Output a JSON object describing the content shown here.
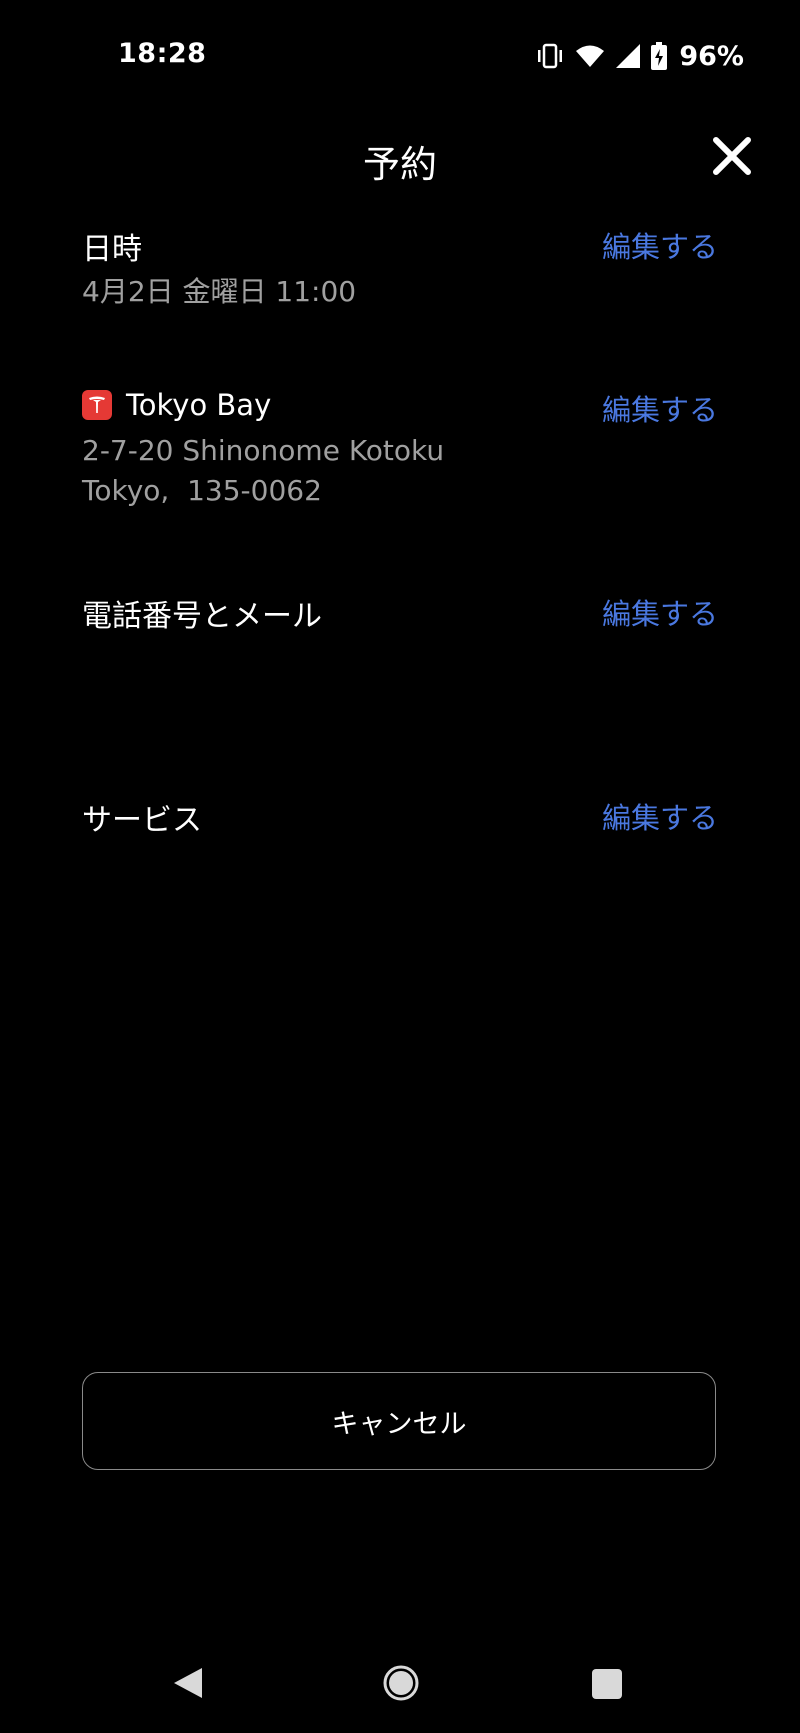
{
  "status_bar": {
    "time": "18:28",
    "battery_percent": "96%",
    "icons": [
      "vibrate-icon",
      "wifi-icon",
      "cell-signal-icon",
      "battery-charging-icon"
    ]
  },
  "header": {
    "title": "予約",
    "close_icon": "close-icon"
  },
  "sections": {
    "datetime": {
      "label": "日時",
      "value": "4月2日 金曜日 11:00",
      "edit": "編集する"
    },
    "location": {
      "name": "Tokyo Bay",
      "address_line1": "2-7-20 Shinonome Kotoku",
      "address_line2": "Tokyo,  135-0062",
      "edit": "編集する",
      "logo_color": "#e53935"
    },
    "contact": {
      "label": "電話番号とメール",
      "edit": "編集する"
    },
    "service": {
      "label": "サービス",
      "edit": "編集する"
    }
  },
  "actions": {
    "cancel_label": "キャンセル"
  },
  "colors": {
    "background": "#000000",
    "accent": "#4a78e0",
    "secondary_text": "#a0a0a0"
  },
  "nav_bar": {
    "icons": [
      "back-icon",
      "home-icon",
      "recents-icon"
    ]
  }
}
